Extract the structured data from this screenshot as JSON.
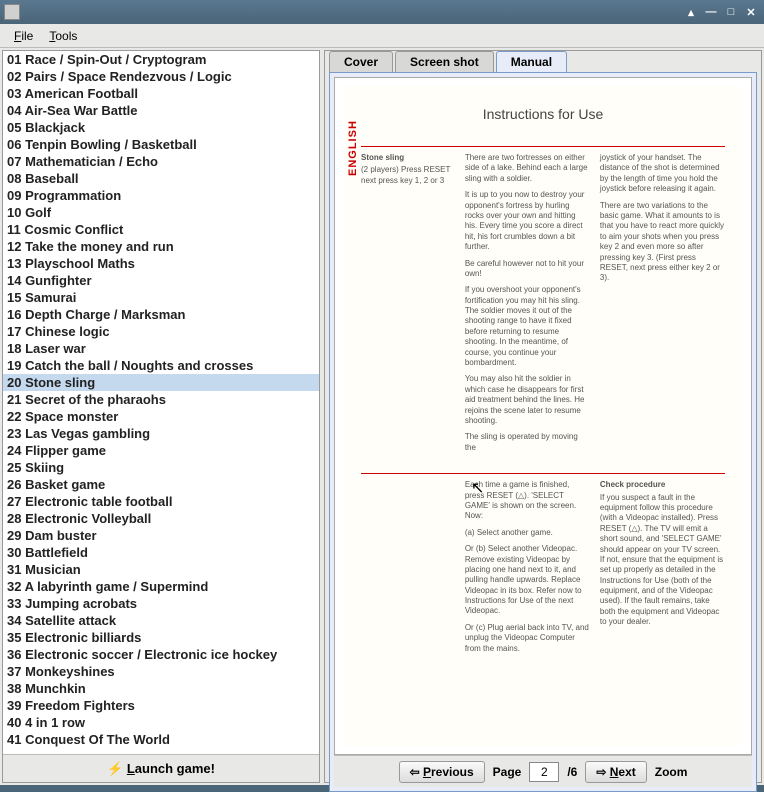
{
  "window": {
    "title": ""
  },
  "menubar": {
    "file": "File",
    "tools": "Tools"
  },
  "games": {
    "selected_index": 19,
    "items": [
      "01 Race / Spin-Out / Cryptogram",
      "02 Pairs / Space Rendezvous / Logic",
      "03 American Football",
      "04 Air-Sea War Battle",
      "05 Blackjack",
      "06 Tenpin Bowling / Basketball",
      "07 Mathematician / Echo",
      "08 Baseball",
      "09 Programmation",
      "10 Golf",
      "11 Cosmic Conflict",
      "12 Take the money and run",
      "13 Playschool Maths",
      "14 Gunfighter",
      "15 Samurai",
      "16 Depth Charge / Marksman",
      "17 Chinese logic",
      "18 Laser war",
      "19 Catch the ball / Noughts and crosses",
      "20 Stone sling",
      "21 Secret of the pharaohs",
      "22 Space monster",
      "23 Las Vegas gambling",
      "24 Flipper game",
      "25 Skiing",
      "26 Basket game",
      "27 Electronic table football",
      "28 Electronic Volleyball",
      "29 Dam buster",
      "30 Battlefield",
      "31 Musician",
      "32 A labyrinth game / Supermind",
      "33 Jumping acrobats",
      "34 Satellite attack",
      "35 Electronic billiards",
      "36 Electronic soccer / Electronic ice hockey",
      "37 Monkeyshines",
      "38 Munchkin",
      "39 Freedom Fighters",
      "40 4 in 1 row",
      "41 Conquest Of The World"
    ]
  },
  "launch": {
    "label": "Launch game!"
  },
  "tabs": {
    "cover": "Cover",
    "screenshot": "Screen shot",
    "manual": "Manual",
    "active": "manual"
  },
  "manual": {
    "title": "Instructions for Use",
    "english_tag": "ENGLISH",
    "col1": {
      "heading": "Stone sling",
      "sub": "(2 players) Press RESET next press key 1, 2 or 3"
    },
    "col2": {
      "p1": "There are two fortresses on either side of a lake. Behind each a large sling with a soldier.",
      "p2": "It is up to you now to destroy your opponent's fortress by hurling rocks over your own and hitting his. Every time you score a direct hit, his fort crumbles down a bit further.",
      "p3": "Be careful however not to hit your own!",
      "p4": "If you overshoot your opponent's fortification you may hit his sling. The soldier moves it out of the shooting range to have it fixed before returning to resume shooting. In the meantime, of course, you continue your bombardment.",
      "p5": "You may also hit the soldier in which case he disappears for first aid treatment behind the lines. He rejoins the scene later to resume shooting.",
      "p6": "The sling is operated by moving the"
    },
    "col3": {
      "p1": "joystick of your handset. The distance of the shot is determined by the length of time you hold the joystick before releasing it again.",
      "p2": "There are two variations to the basic game. What it amounts to is that you have to react more quickly to aim your shots when you press key 2 and even more so after pressing key 3. (First press RESET, next press either key 2 or 3)."
    },
    "bot_col2": {
      "p1": "Each time a game is finished, press RESET (△). 'SELECT GAME' is shown on the screen. Now:",
      "a": "(a) Select another game.",
      "b": "Or (b) Select another Videopac. Remove existing Videopac by placing one hand next to it, and pulling handle upwards. Replace Videopac in its box. Refer now to Instructions for Use of the next Videopac.",
      "c": "Or (c) Plug aerial back into TV, and unplug the Videopac Computer from the mains."
    },
    "bot_col3": {
      "heading": "Check procedure",
      "p1": "If you suspect a fault in the equipment follow this procedure (with a Videopac installed). Press RESET (△). The TV will emit a short sound, and 'SELECT GAME' should appear on your TV screen. If not, ensure that the equipment is set up properly as detailed in the Instructions for Use (both of the equipment, and of the Videopac used). If the fault remains, take both the equipment and Videopac to your dealer."
    }
  },
  "nav": {
    "previous": "Previous",
    "next": "Next",
    "page_label": "Page",
    "page_value": "2",
    "page_total": "/6",
    "zoom": "Zoom"
  }
}
